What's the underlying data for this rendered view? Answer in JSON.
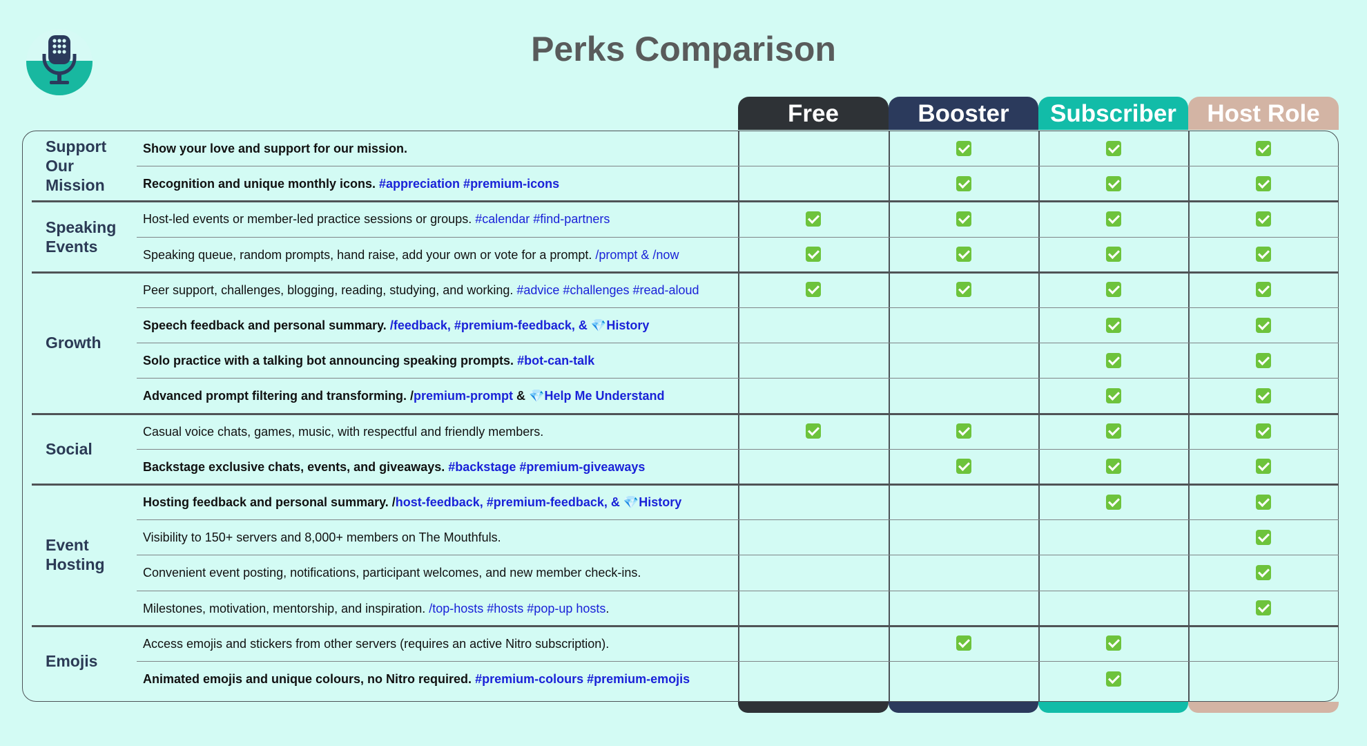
{
  "title": "Perks Comparison",
  "logo_icon": "microphone-icon",
  "columns": [
    {
      "key": "free",
      "label": "Free",
      "color": "#2e3236"
    },
    {
      "key": "booster",
      "label": "Booster",
      "color": "#2b3a5c"
    },
    {
      "key": "subscriber",
      "label": "Subscriber",
      "color": "#12bca8"
    },
    {
      "key": "host",
      "label": "Host Role",
      "color": "#d3b4a4"
    }
  ],
  "sections": [
    {
      "label": "Support Our Mission",
      "rows": [
        {
          "bold": true,
          "text": "Show your love and support for our mission.",
          "tags": "",
          "checks": [
            false,
            true,
            true,
            true
          ]
        },
        {
          "bold": true,
          "text": "Recognition and unique monthly icons.",
          "tags": "#appreciation #premium-icons",
          "checks": [
            false,
            true,
            true,
            true
          ]
        }
      ]
    },
    {
      "label": "Speaking Events",
      "rows": [
        {
          "bold": false,
          "text": "Host-led events or member-led practice sessions or groups.",
          "tags": "#calendar #find-partners",
          "checks": [
            true,
            true,
            true,
            true
          ]
        },
        {
          "bold": false,
          "text": "Speaking queue, random prompts, hand raise, add your own or vote for a prompt.",
          "tags": "/prompt & /now",
          "checks": [
            true,
            true,
            true,
            true
          ]
        }
      ]
    },
    {
      "label": "Growth",
      "rows": [
        {
          "bold": false,
          "text": "Peer support, challenges, blogging, reading, studying, and working.",
          "tags": "#advice #challenges #read-aloud",
          "checks": [
            true,
            true,
            true,
            true
          ]
        },
        {
          "bold": true,
          "text": "Speech feedback and personal summary.",
          "tags": "/feedback, #premium-feedback, & 💎History",
          "checks": [
            false,
            false,
            true,
            true
          ]
        },
        {
          "bold": true,
          "text": "Solo practice with a talking bot announcing speaking prompts.",
          "tags": "#bot-can-talk",
          "checks": [
            false,
            false,
            true,
            true
          ]
        },
        {
          "bold": true,
          "text": "Advanced prompt filtering and transforming. /",
          "tags": "premium-prompt",
          "suffix": " & ",
          "tags2": "💎Help Me Understand",
          "checks": [
            false,
            false,
            true,
            true
          ]
        }
      ]
    },
    {
      "label": "Social",
      "rows": [
        {
          "bold": false,
          "text": "Casual voice chats, games, music, with respectful and friendly members.",
          "tags": "",
          "checks": [
            true,
            true,
            true,
            true
          ]
        },
        {
          "bold": true,
          "text": "Backstage exclusive chats, events, and giveaways.",
          "tags": "#backstage #premium-giveaways",
          "checks": [
            false,
            true,
            true,
            true
          ]
        }
      ]
    },
    {
      "label": "Event Hosting",
      "rows": [
        {
          "bold": true,
          "text": "Hosting feedback and personal summary. /",
          "tags": "host-feedback, #premium-feedback, & 💎History",
          "checks": [
            false,
            false,
            true,
            true
          ]
        },
        {
          "bold": false,
          "text": "Visibility to 150+ servers and 8,000+ members on The Mouthfuls.",
          "tags": "",
          "checks": [
            false,
            false,
            false,
            true
          ]
        },
        {
          "bold": false,
          "text": "Convenient event posting, notifications, participant welcomes, and new member check-ins.",
          "tags": "",
          "checks": [
            false,
            false,
            false,
            true
          ]
        },
        {
          "bold": false,
          "text": "Milestones, motivation, mentorship, and inspiration.",
          "tags": "/top-hosts #hosts #pop-up hosts",
          "suffix": ".",
          "checks": [
            false,
            false,
            false,
            true
          ]
        }
      ]
    },
    {
      "label": "Emojis",
      "rows": [
        {
          "bold": false,
          "text": "Access emojis and stickers from other servers (requires an active Nitro subscription).",
          "tags": "",
          "checks": [
            false,
            true,
            true,
            false
          ]
        },
        {
          "bold": true,
          "text": "Animated emojis and unique colours, no Nitro required.",
          "tags": "#premium-colours #premium-emojis",
          "checks": [
            false,
            false,
            true,
            false
          ]
        }
      ]
    }
  ]
}
